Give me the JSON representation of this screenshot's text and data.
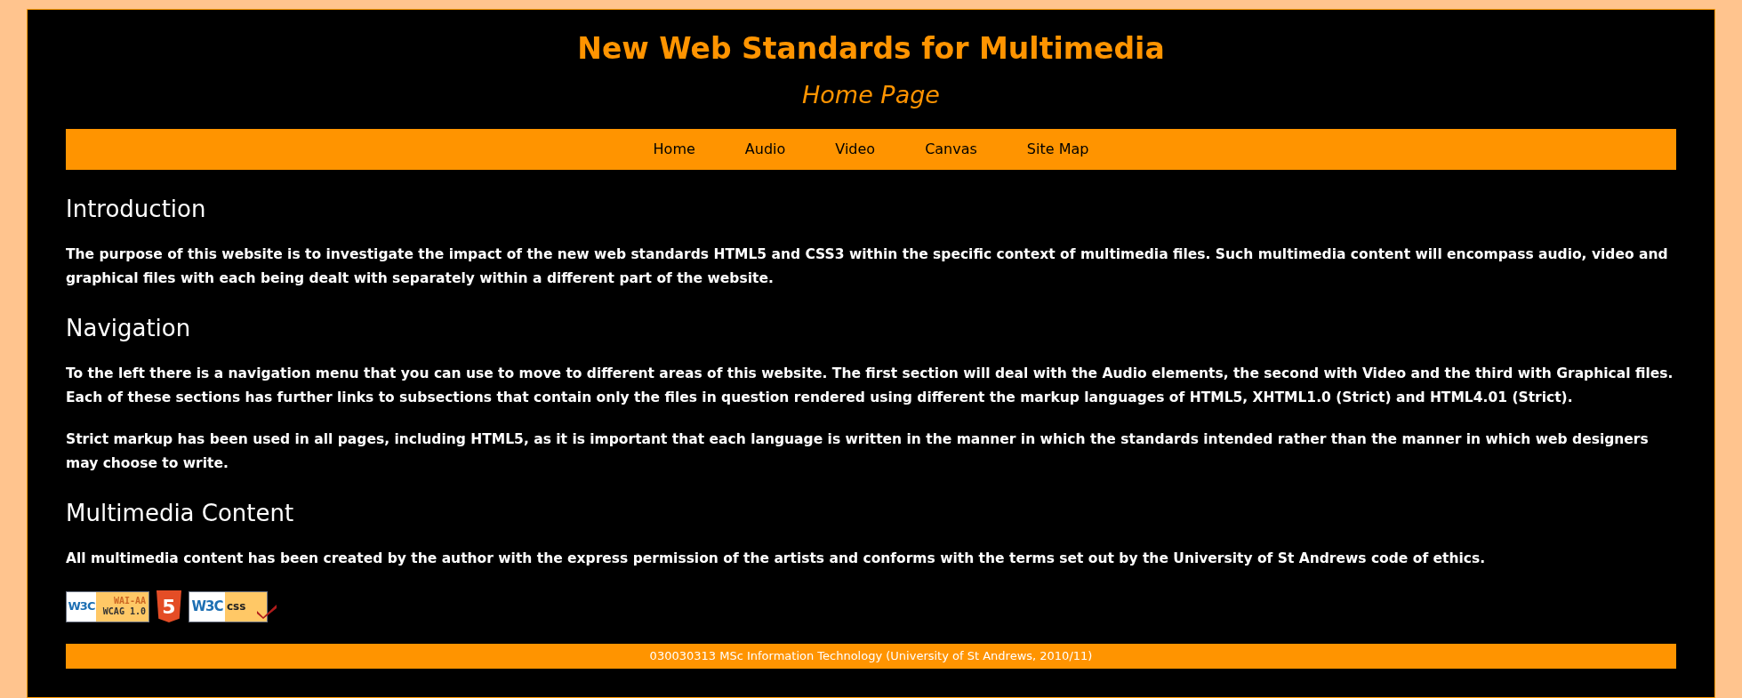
{
  "header": {
    "title": "New Web Standards for Multimedia",
    "subtitle": "Home Page"
  },
  "nav": [
    {
      "label": "Home"
    },
    {
      "label": "Audio"
    },
    {
      "label": "Video"
    },
    {
      "label": "Canvas"
    },
    {
      "label": "Site Map"
    }
  ],
  "sections": [
    {
      "heading": "Introduction",
      "paragraphs": [
        "The purpose of this website is to investigate the impact of the new web standards HTML5 and CSS3 within the specific context of multimedia files. Such multimedia content will encompass audio, video and graphical files with each being dealt with separately within a different part of the website."
      ]
    },
    {
      "heading": "Navigation",
      "paragraphs": [
        "To the left there is a navigation menu that you can use to move to different areas of this website. The first section will deal with the Audio elements, the second with Video and the third with Graphical files. Each of these sections has further links to subsections that contain only the files in question rendered using different the markup languages of HTML5, XHTML1.0 (Strict) and HTML4.01 (Strict).",
        "Strict markup has been used in all pages, including HTML5, as it is important that each language is written in the manner in which the standards intended rather than the manner in which web designers may choose to write."
      ]
    },
    {
      "heading": "Multimedia Content",
      "paragraphs": [
        "All multimedia content has been created by the author with the express permission of the artists and conforms with the terms set out by the University of St Andrews code of ethics."
      ]
    }
  ],
  "badges": [
    {
      "kind": "wai",
      "logo": "W3C",
      "line_1": "WAI-AA",
      "line_2": "WCAG 1.0"
    },
    {
      "kind": "html5",
      "logo": "5"
    },
    {
      "kind": "css",
      "logo": "W3C",
      "label": "css"
    }
  ],
  "footer": "030030313 MSc Information Technology (University of St Andrews, 2010/11)"
}
